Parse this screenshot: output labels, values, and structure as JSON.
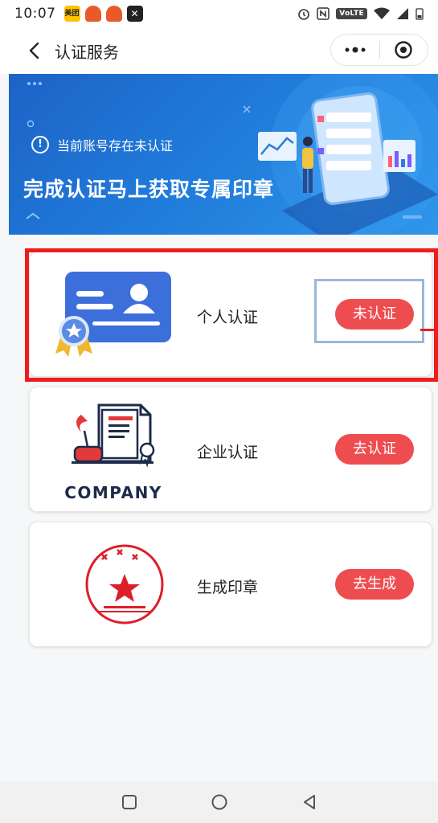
{
  "status_bar": {
    "time": "10:07",
    "app_icons": [
      "meituan-icon",
      "red-app-icon",
      "red-app-icon",
      "capcut-icon"
    ],
    "meituan_label": "美团",
    "volte_label": "VoLTE"
  },
  "nav": {
    "title": "认证服务"
  },
  "banner": {
    "notice_text": "当前账号存在未认证",
    "notice_icon_text": "!",
    "headline": "完成认证马上获取专属印章",
    "colors": {
      "start": "#1e63c7",
      "end": "#2e96ea"
    }
  },
  "cards": [
    {
      "label": "个人认证",
      "action": "未认证",
      "icon": "id-card-icon"
    },
    {
      "label": "企业认证",
      "action": "去认证",
      "icon": "company-certificate-icon",
      "logo_text": "COMPANY"
    },
    {
      "label": "生成印章",
      "action": "去生成",
      "icon": "stamp-icon"
    }
  ],
  "colors": {
    "accent_red": "#ee4d50",
    "card_icon_blue": "#3d6fdb",
    "highlight_red": "#ee1c1c",
    "highlight_blue": "#9ab7d8"
  }
}
